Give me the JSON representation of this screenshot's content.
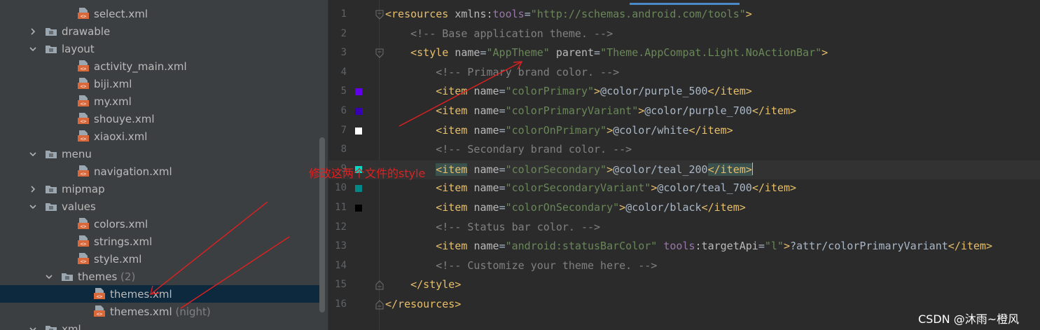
{
  "project_tree": {
    "items": [
      {
        "label": "select.xml",
        "suffix": "",
        "kind": "xml-file",
        "expanded": null,
        "selected": false
      },
      {
        "label": "drawable",
        "suffix": "",
        "kind": "folder",
        "expanded": false,
        "selected": false
      },
      {
        "label": "layout",
        "suffix": "",
        "kind": "folder",
        "expanded": true,
        "selected": false
      },
      {
        "label": "activity_main.xml",
        "suffix": "",
        "kind": "xml-file",
        "expanded": null,
        "selected": false
      },
      {
        "label": "biji.xml",
        "suffix": "",
        "kind": "xml-file",
        "expanded": null,
        "selected": false
      },
      {
        "label": "my.xml",
        "suffix": "",
        "kind": "xml-file",
        "expanded": null,
        "selected": false
      },
      {
        "label": "shouye.xml",
        "suffix": "",
        "kind": "xml-file",
        "expanded": null,
        "selected": false
      },
      {
        "label": "xiaoxi.xml",
        "suffix": "",
        "kind": "xml-file",
        "expanded": null,
        "selected": false
      },
      {
        "label": "menu",
        "suffix": "",
        "kind": "folder",
        "expanded": true,
        "selected": false
      },
      {
        "label": "navigation.xml",
        "suffix": "",
        "kind": "xml-file",
        "expanded": null,
        "selected": false
      },
      {
        "label": "mipmap",
        "suffix": "",
        "kind": "folder",
        "expanded": false,
        "selected": false
      },
      {
        "label": "values",
        "suffix": "",
        "kind": "folder",
        "expanded": true,
        "selected": false
      },
      {
        "label": "colors.xml",
        "suffix": "",
        "kind": "xml-file",
        "expanded": null,
        "selected": false
      },
      {
        "label": "strings.xml",
        "suffix": "",
        "kind": "xml-file",
        "expanded": null,
        "selected": false
      },
      {
        "label": "style.xml",
        "suffix": "",
        "kind": "xml-file",
        "expanded": null,
        "selected": false
      },
      {
        "label": "themes",
        "suffix": " (2)",
        "kind": "folder",
        "expanded": true,
        "selected": false
      },
      {
        "label": "themes.xml",
        "suffix": "",
        "kind": "xml-file",
        "expanded": null,
        "selected": true
      },
      {
        "label": "themes.xml",
        "suffix": " (night)",
        "kind": "xml-file",
        "expanded": null,
        "selected": false
      },
      {
        "label": "xml",
        "suffix": "",
        "kind": "folder",
        "expanded": true,
        "selected": false
      }
    ]
  },
  "editor": {
    "current_line": 9,
    "lines": [
      {
        "num": "1",
        "swatch": null,
        "fold": "open",
        "tokens": [
          [
            "tag",
            "<resources "
          ],
          [
            "attr",
            "xmlns:"
          ],
          [
            "ns",
            "tools"
          ],
          [
            "txt",
            "="
          ],
          [
            "val",
            "\"http://schemas.android.com/tools\""
          ],
          [
            "tag",
            ">"
          ]
        ]
      },
      {
        "num": "2",
        "swatch": null,
        "fold": null,
        "tokens": [
          [
            "txt",
            "    "
          ],
          [
            "com",
            "<!-- Base application theme. -->"
          ]
        ]
      },
      {
        "num": "3",
        "swatch": null,
        "fold": "open",
        "tokens": [
          [
            "txt",
            "    "
          ],
          [
            "tag",
            "<style "
          ],
          [
            "attr",
            "name"
          ],
          [
            "txt",
            "="
          ],
          [
            "val",
            "\"AppTheme\""
          ],
          [
            "txt",
            " "
          ],
          [
            "attr",
            "parent"
          ],
          [
            "txt",
            "="
          ],
          [
            "val",
            "\"Theme.AppCompat.Light.NoActionBar\""
          ],
          [
            "tag",
            ">"
          ]
        ]
      },
      {
        "num": "4",
        "swatch": null,
        "fold": null,
        "tokens": [
          [
            "txt",
            "        "
          ],
          [
            "com",
            "<!-- Primary brand color. -->"
          ]
        ]
      },
      {
        "num": "5",
        "swatch": "#6200ee",
        "fold": null,
        "tokens": [
          [
            "txt",
            "        "
          ],
          [
            "tag",
            "<item "
          ],
          [
            "attr",
            "name"
          ],
          [
            "txt",
            "="
          ],
          [
            "val",
            "\"colorPrimary\""
          ],
          [
            "tag",
            ">"
          ],
          [
            "txt",
            "@color/purple_500"
          ],
          [
            "tag",
            "</item>"
          ]
        ]
      },
      {
        "num": "6",
        "swatch": "#3700b3",
        "fold": null,
        "tokens": [
          [
            "txt",
            "        "
          ],
          [
            "tag",
            "<item "
          ],
          [
            "attr",
            "name"
          ],
          [
            "txt",
            "="
          ],
          [
            "val",
            "\"colorPrimaryVariant\""
          ],
          [
            "tag",
            ">"
          ],
          [
            "txt",
            "@color/purple_700"
          ],
          [
            "tag",
            "</item>"
          ]
        ]
      },
      {
        "num": "7",
        "swatch": "#ffffff",
        "fold": null,
        "tokens": [
          [
            "txt",
            "        "
          ],
          [
            "tag",
            "<item "
          ],
          [
            "attr",
            "name"
          ],
          [
            "txt",
            "="
          ],
          [
            "val",
            "\"colorOnPrimary\""
          ],
          [
            "tag",
            ">"
          ],
          [
            "txt",
            "@color/white"
          ],
          [
            "tag",
            "</item>"
          ]
        ]
      },
      {
        "num": "8",
        "swatch": null,
        "fold": null,
        "tokens": [
          [
            "txt",
            "        "
          ],
          [
            "com",
            "<!-- Secondary brand color. -->"
          ]
        ]
      },
      {
        "num": "9",
        "swatch": "#03dac5",
        "fold": null,
        "tokens": [
          [
            "txt",
            "        "
          ],
          [
            "hltag",
            "<item"
          ],
          [
            "txt",
            " "
          ],
          [
            "attr",
            "name"
          ],
          [
            "txt",
            "="
          ],
          [
            "val",
            "\"colorSecondary\""
          ],
          [
            "tag",
            ">"
          ],
          [
            "txt",
            "@color/teal_200"
          ],
          [
            "hltag",
            "</item>"
          ],
          [
            "caret",
            ""
          ]
        ]
      },
      {
        "num": "10",
        "swatch": "#018786",
        "fold": null,
        "tokens": [
          [
            "txt",
            "        "
          ],
          [
            "tag",
            "<item "
          ],
          [
            "attr",
            "name"
          ],
          [
            "txt",
            "="
          ],
          [
            "val",
            "\"colorSecondaryVariant\""
          ],
          [
            "tag",
            ">"
          ],
          [
            "txt",
            "@color/teal_700"
          ],
          [
            "tag",
            "</item>"
          ]
        ]
      },
      {
        "num": "11",
        "swatch": "#000000",
        "fold": null,
        "tokens": [
          [
            "txt",
            "        "
          ],
          [
            "tag",
            "<item "
          ],
          [
            "attr",
            "name"
          ],
          [
            "txt",
            "="
          ],
          [
            "val",
            "\"colorOnSecondary\""
          ],
          [
            "tag",
            ">"
          ],
          [
            "txt",
            "@color/black"
          ],
          [
            "tag",
            "</item>"
          ]
        ]
      },
      {
        "num": "12",
        "swatch": null,
        "fold": null,
        "tokens": [
          [
            "txt",
            "        "
          ],
          [
            "com",
            "<!-- Status bar color. -->"
          ]
        ]
      },
      {
        "num": "13",
        "swatch": null,
        "fold": null,
        "tokens": [
          [
            "txt",
            "        "
          ],
          [
            "tag",
            "<item "
          ],
          [
            "attr",
            "name"
          ],
          [
            "txt",
            "="
          ],
          [
            "val",
            "\"android:statusBarColor\""
          ],
          [
            "txt",
            " "
          ],
          [
            "ns",
            "tools"
          ],
          [
            "attr",
            ":targetApi"
          ],
          [
            "txt",
            "="
          ],
          [
            "val",
            "\"l\""
          ],
          [
            "tag",
            ">"
          ],
          [
            "txt",
            "?attr/colorPrimaryVariant"
          ],
          [
            "tag",
            "</item>"
          ]
        ]
      },
      {
        "num": "14",
        "swatch": null,
        "fold": null,
        "tokens": [
          [
            "txt",
            "        "
          ],
          [
            "com",
            "<!-- Customize your theme here. -->"
          ]
        ]
      },
      {
        "num": "15",
        "swatch": null,
        "fold": "close",
        "tokens": [
          [
            "txt",
            "    "
          ],
          [
            "tag",
            "</style>"
          ]
        ]
      },
      {
        "num": "16",
        "swatch": null,
        "fold": "close",
        "tokens": [
          [
            "tag",
            "</resources>"
          ]
        ]
      }
    ]
  },
  "annotation": {
    "text": "修改这两个文件的style",
    "color": "#e02020"
  },
  "watermark": {
    "text": "CSDN @沐雨~橙风"
  },
  "colors": {
    "tree_bg": "#3c3f41",
    "tree_selected": "#0d293e",
    "editor_bg": "#2b2b2b",
    "tag": "#e8bf6a",
    "value": "#6a8759",
    "comment": "#808080",
    "namespace": "#9876aa"
  }
}
